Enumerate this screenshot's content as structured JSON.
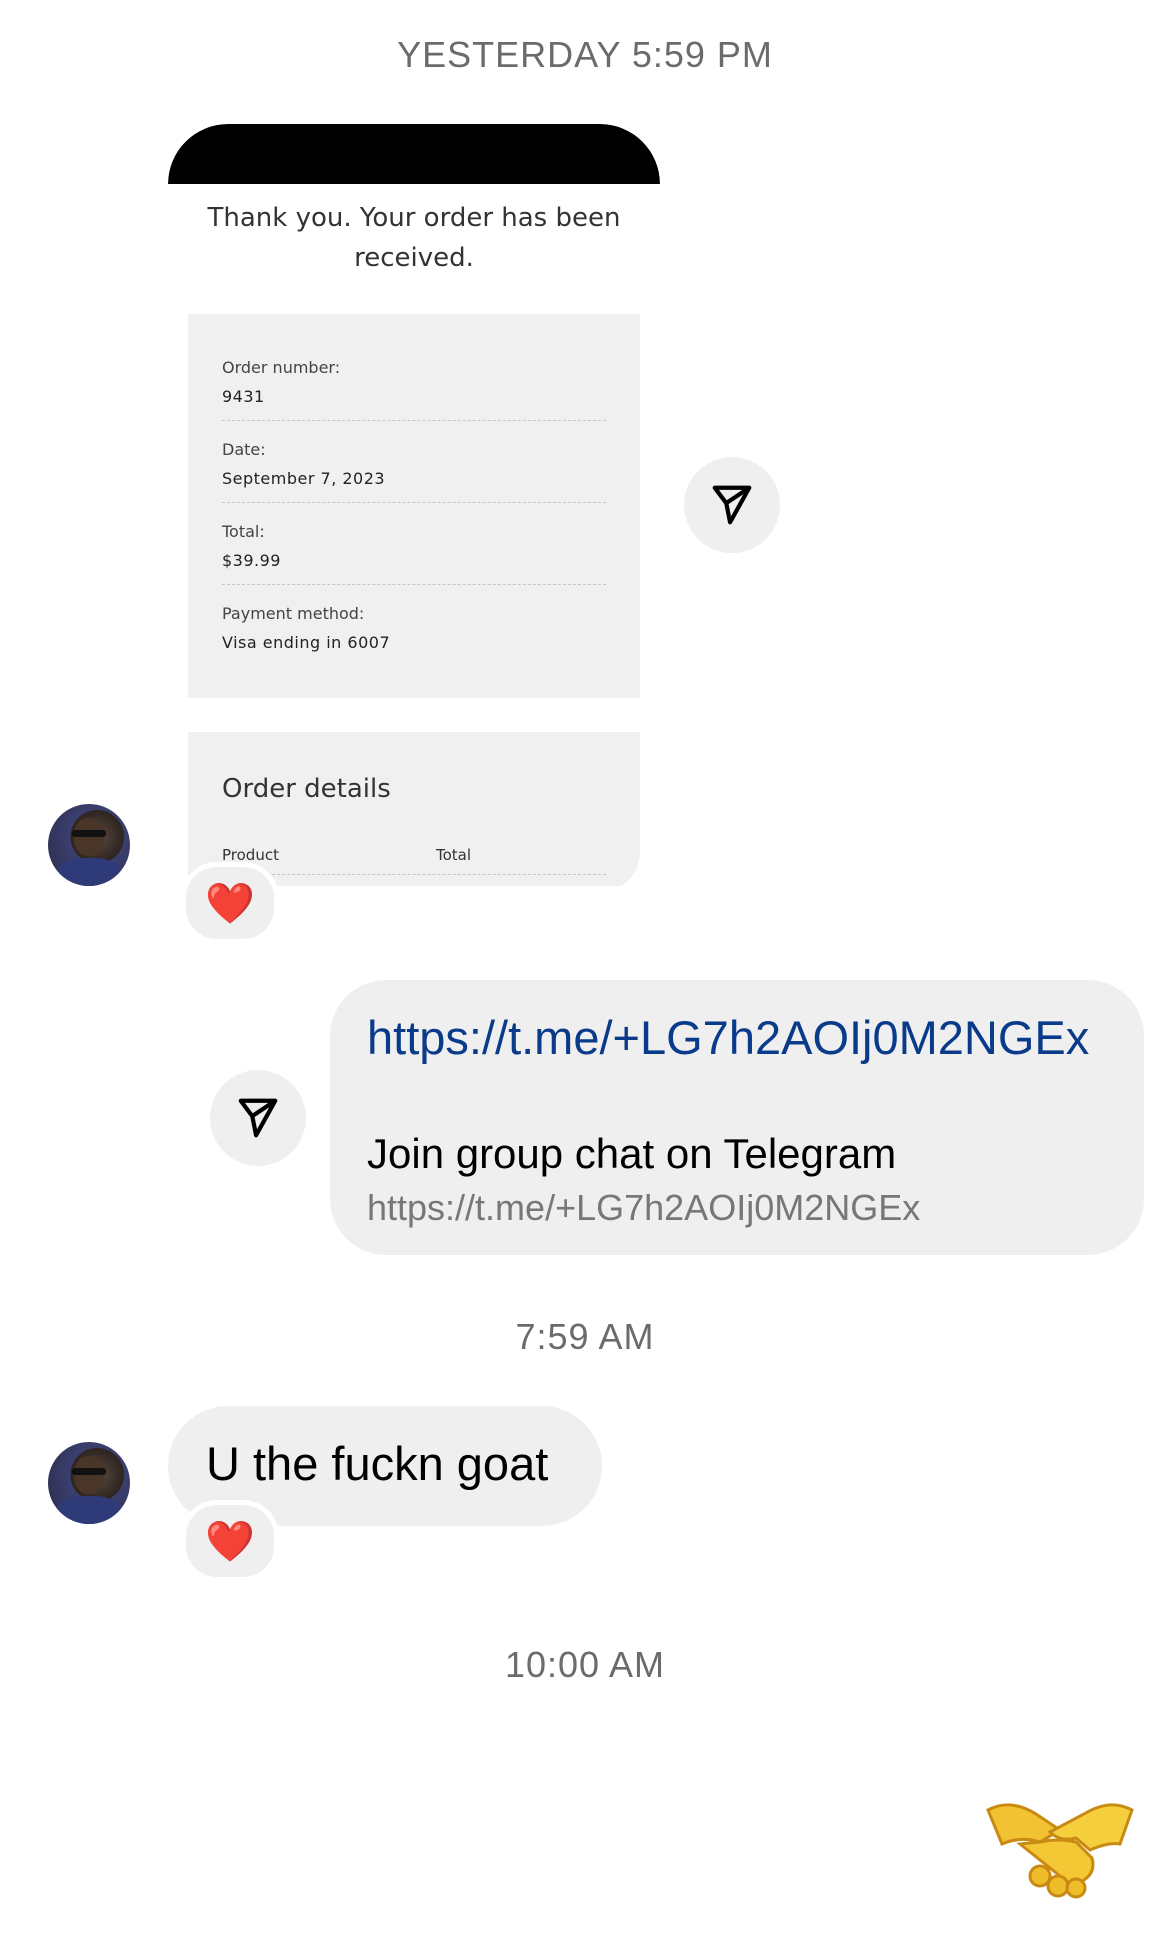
{
  "timestamps": {
    "t1": "YESTERDAY 5:59 PM",
    "t2": "7:59 AM",
    "t3": "10:00 AM"
  },
  "receipt": {
    "thanks": "Thank you. Your order has been received.",
    "order_number_label": "Order number:",
    "order_number": "9431",
    "date_label": "Date:",
    "date": "September 7, 2023",
    "total_label": "Total:",
    "total": "$39.99",
    "payment_label": "Payment method:",
    "payment": "Visa ending in 6007",
    "details_heading": "Order details",
    "col_product": "Product",
    "col_total": "Total"
  },
  "link_message": {
    "url": "https://t.me/+LG7h2AOIj0M2NGEx",
    "title": "Join group chat on Telegram",
    "subtitle": "https://t.me/+LG7h2AOIj0M2NGEx"
  },
  "text_message": {
    "text": "U the fuckn goat"
  },
  "reactions": {
    "heart": "❤️"
  },
  "icons": {
    "share": "paper-plane-icon",
    "handshake": "handshake-emoji"
  }
}
